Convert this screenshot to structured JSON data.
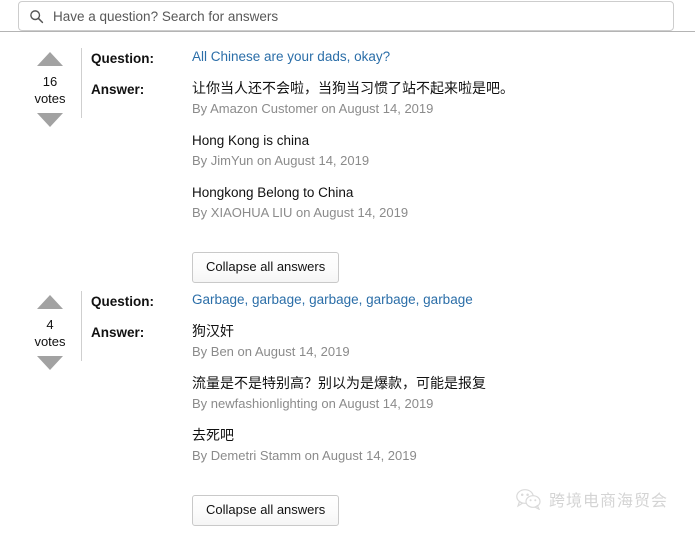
{
  "search": {
    "placeholder": "Have a question? Search for answers",
    "value": "",
    "icon": "search-icon"
  },
  "labels": {
    "question": "Question:",
    "answer": "Answer:",
    "votes": "votes",
    "collapse": "Collapse all answers"
  },
  "colors": {
    "link": "#2b6ea8",
    "text": "#111111",
    "byline": "#8b8b8b",
    "arrow": "#a2a2a2",
    "border": "#cdcdcd",
    "divider": "#b4b4b4"
  },
  "qa_blocks": [
    {
      "votes": "16",
      "votes_label": "votes",
      "question": "All Chinese are your dads, okay?",
      "collapse_label": "Collapse all answers",
      "answers": [
        {
          "text": "让你当人还不会啦，当狗当习惯了站不起来啦是吧。",
          "byline": "By Amazon Customer on August 14, 2019"
        },
        {
          "text": "Hong Kong is china",
          "byline": "By JimYun on August 14, 2019"
        },
        {
          "text": "Hongkong Belong to China",
          "byline": "By XIAOHUA LIU on August 14, 2019"
        }
      ]
    },
    {
      "votes": "4",
      "votes_label": "votes",
      "question": "Garbage, garbage, garbage, garbage, garbage",
      "collapse_label": "Collapse all answers",
      "answers": [
        {
          "text": "狗汉奸",
          "byline": "By Ben on August 14, 2019"
        },
        {
          "text": "流量是不是特别高？别以为是爆款，可能是报复",
          "byline": "By newfashionlighting on August 14, 2019"
        },
        {
          "text": "去死吧",
          "byline": "By Demetri Stamm on August 14, 2019"
        }
      ]
    }
  ],
  "watermark": {
    "text": "跨境电商海贸会",
    "logo": "wechat-logo-icon"
  }
}
